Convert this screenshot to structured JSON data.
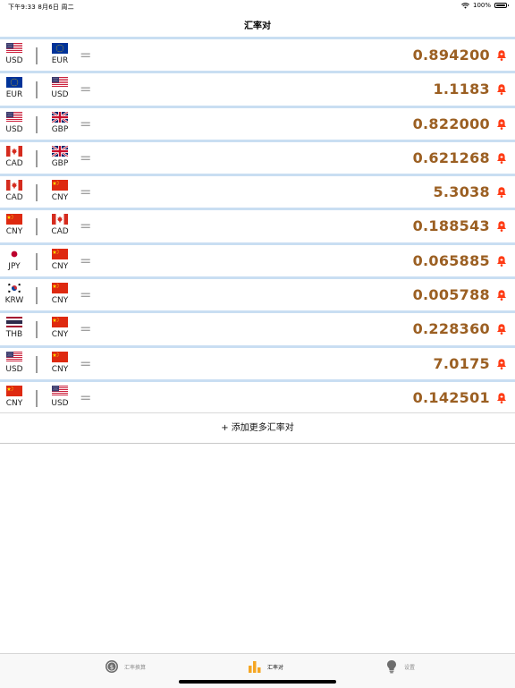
{
  "status_bar": {
    "time_date": "下午9:33   8月6日 周二",
    "battery": "100%",
    "battery_level": 1.0
  },
  "header": {
    "title": "汇率对"
  },
  "pairs": [
    {
      "base": "USD",
      "quote": "EUR",
      "rate": "0.894200",
      "base_flag": "us-flag",
      "quote_flag": "eu-flag"
    },
    {
      "base": "EUR",
      "quote": "USD",
      "rate": "1.1183",
      "base_flag": "eu-flag",
      "quote_flag": "us-flag"
    },
    {
      "base": "USD",
      "quote": "GBP",
      "rate": "0.822000",
      "base_flag": "us-flag",
      "quote_flag": "gb-flag"
    },
    {
      "base": "CAD",
      "quote": "GBP",
      "rate": "0.621268",
      "base_flag": "ca-flag",
      "quote_flag": "gb-flag"
    },
    {
      "base": "CAD",
      "quote": "CNY",
      "rate": "5.3038",
      "base_flag": "ca-flag",
      "quote_flag": "cn-flag"
    },
    {
      "base": "CNY",
      "quote": "CAD",
      "rate": "0.188543",
      "base_flag": "cn-flag",
      "quote_flag": "ca-flag"
    },
    {
      "base": "JPY",
      "quote": "CNY",
      "rate": "0.065885",
      "base_flag": "jp-flag",
      "quote_flag": "cn-flag"
    },
    {
      "base": "KRW",
      "quote": "CNY",
      "rate": "0.005788",
      "base_flag": "kr-flag",
      "quote_flag": "cn-flag"
    },
    {
      "base": "THB",
      "quote": "CNY",
      "rate": "0.228360",
      "base_flag": "th-flag",
      "quote_flag": "cn-flag"
    },
    {
      "base": "USD",
      "quote": "CNY",
      "rate": "7.0175",
      "base_flag": "us-flag",
      "quote_flag": "cn-flag"
    },
    {
      "base": "CNY",
      "quote": "USD",
      "rate": "0.142501",
      "base_flag": "cn-flag",
      "quote_flag": "us-flag"
    }
  ],
  "equals_sign": "=",
  "add_button": {
    "label": "+ 添加更多汇率对"
  },
  "tab_bar": {
    "tabs": [
      {
        "label": "汇率换算",
        "icon": "currency-coin-icon",
        "active": false
      },
      {
        "label": "汇率对",
        "icon": "bar-chart-icon",
        "active": true
      },
      {
        "label": "设置",
        "icon": "lightbulb-icon",
        "active": false
      }
    ]
  },
  "colors": {
    "rate_text": "#9b5f22",
    "bell": "#ff3b14",
    "row_separator": "#c9def2",
    "active_tab": "#f5a623"
  }
}
